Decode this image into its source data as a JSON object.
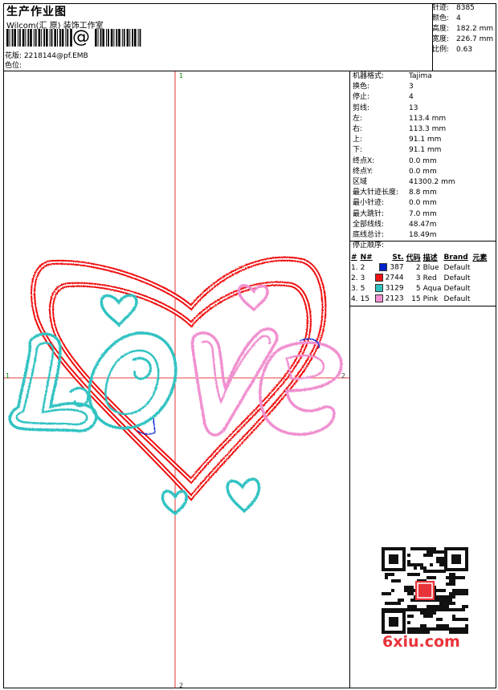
{
  "header": {
    "title": "生产作业图",
    "company": "Wilcom(汇 原) 装饰工作室",
    "barcode_symbol": "@",
    "pattern_label": "花版:",
    "pattern_value": "2218144@pf.EMB",
    "color_label": "色位:"
  },
  "top_info": [
    {
      "label": "针迹:",
      "value": "8385"
    },
    {
      "label": "颜色:",
      "value": "4"
    },
    {
      "label": "高度:",
      "value": "182.2 mm"
    },
    {
      "label": "宽度:",
      "value": "226.7 mm"
    },
    {
      "label": "比例:",
      "value": "0.63"
    }
  ],
  "stats": [
    {
      "label": "机器格式:",
      "value": "Tajima"
    },
    {
      "label": "换色:",
      "value": "3"
    },
    {
      "label": "停止:",
      "value": "4"
    },
    {
      "label": "剪线:",
      "value": "13"
    },
    {
      "label": "左:",
      "value": "113.4 mm"
    },
    {
      "label": "右:",
      "value": "113.3 mm"
    },
    {
      "label": "上:",
      "value": "91.1 mm"
    },
    {
      "label": "下:",
      "value": "91.1 mm"
    },
    {
      "label": "终点X:",
      "value": "0.0 mm"
    },
    {
      "label": "终点Y:",
      "value": "0.0 mm"
    },
    {
      "label": "区域",
      "value": "41300.2 mm"
    },
    {
      "label": "最大针迹长度:",
      "value": "8.8 mm"
    },
    {
      "label": "最小针迹:",
      "value": "0.0 mm"
    },
    {
      "label": "最大跳针:",
      "value": "7.0 mm"
    },
    {
      "label": "全部线线:",
      "value": "48.47m"
    },
    {
      "label": "底线总计:",
      "value": "18.49m"
    },
    {
      "label": "停止顺序:",
      "value": ""
    }
  ],
  "color_table": {
    "headers": [
      "#",
      "N#",
      "St.",
      "代码",
      "描述",
      "Brand",
      "元素"
    ],
    "rows": [
      {
        "idx": "1.",
        "n": "2",
        "color": "#0022cc",
        "st": "387",
        "code": "2",
        "desc": "Blue",
        "brand": "Default"
      },
      {
        "idx": "2.",
        "n": "3",
        "color": "#ee1111",
        "st": "2744",
        "code": "3",
        "desc": "Red",
        "brand": "Default"
      },
      {
        "idx": "3.",
        "n": "5",
        "color": "#33c2c2",
        "st": "3129",
        "code": "5",
        "desc": "Aqua",
        "brand": "Default"
      },
      {
        "idx": "4.",
        "n": "15",
        "color": "#f090d0",
        "st": "2123",
        "code": "15",
        "desc": "Pink",
        "brand": "Default"
      }
    ]
  },
  "axis_labels": {
    "top": "1",
    "left": "1",
    "right": "2",
    "bottom": "2"
  },
  "design_colors": {
    "heart": "#ee1111",
    "aqua": "#33c2c2",
    "pink": "#f090d0",
    "crosshair": "#dd0000"
  },
  "watermark": {
    "text": "6xiu.com"
  }
}
